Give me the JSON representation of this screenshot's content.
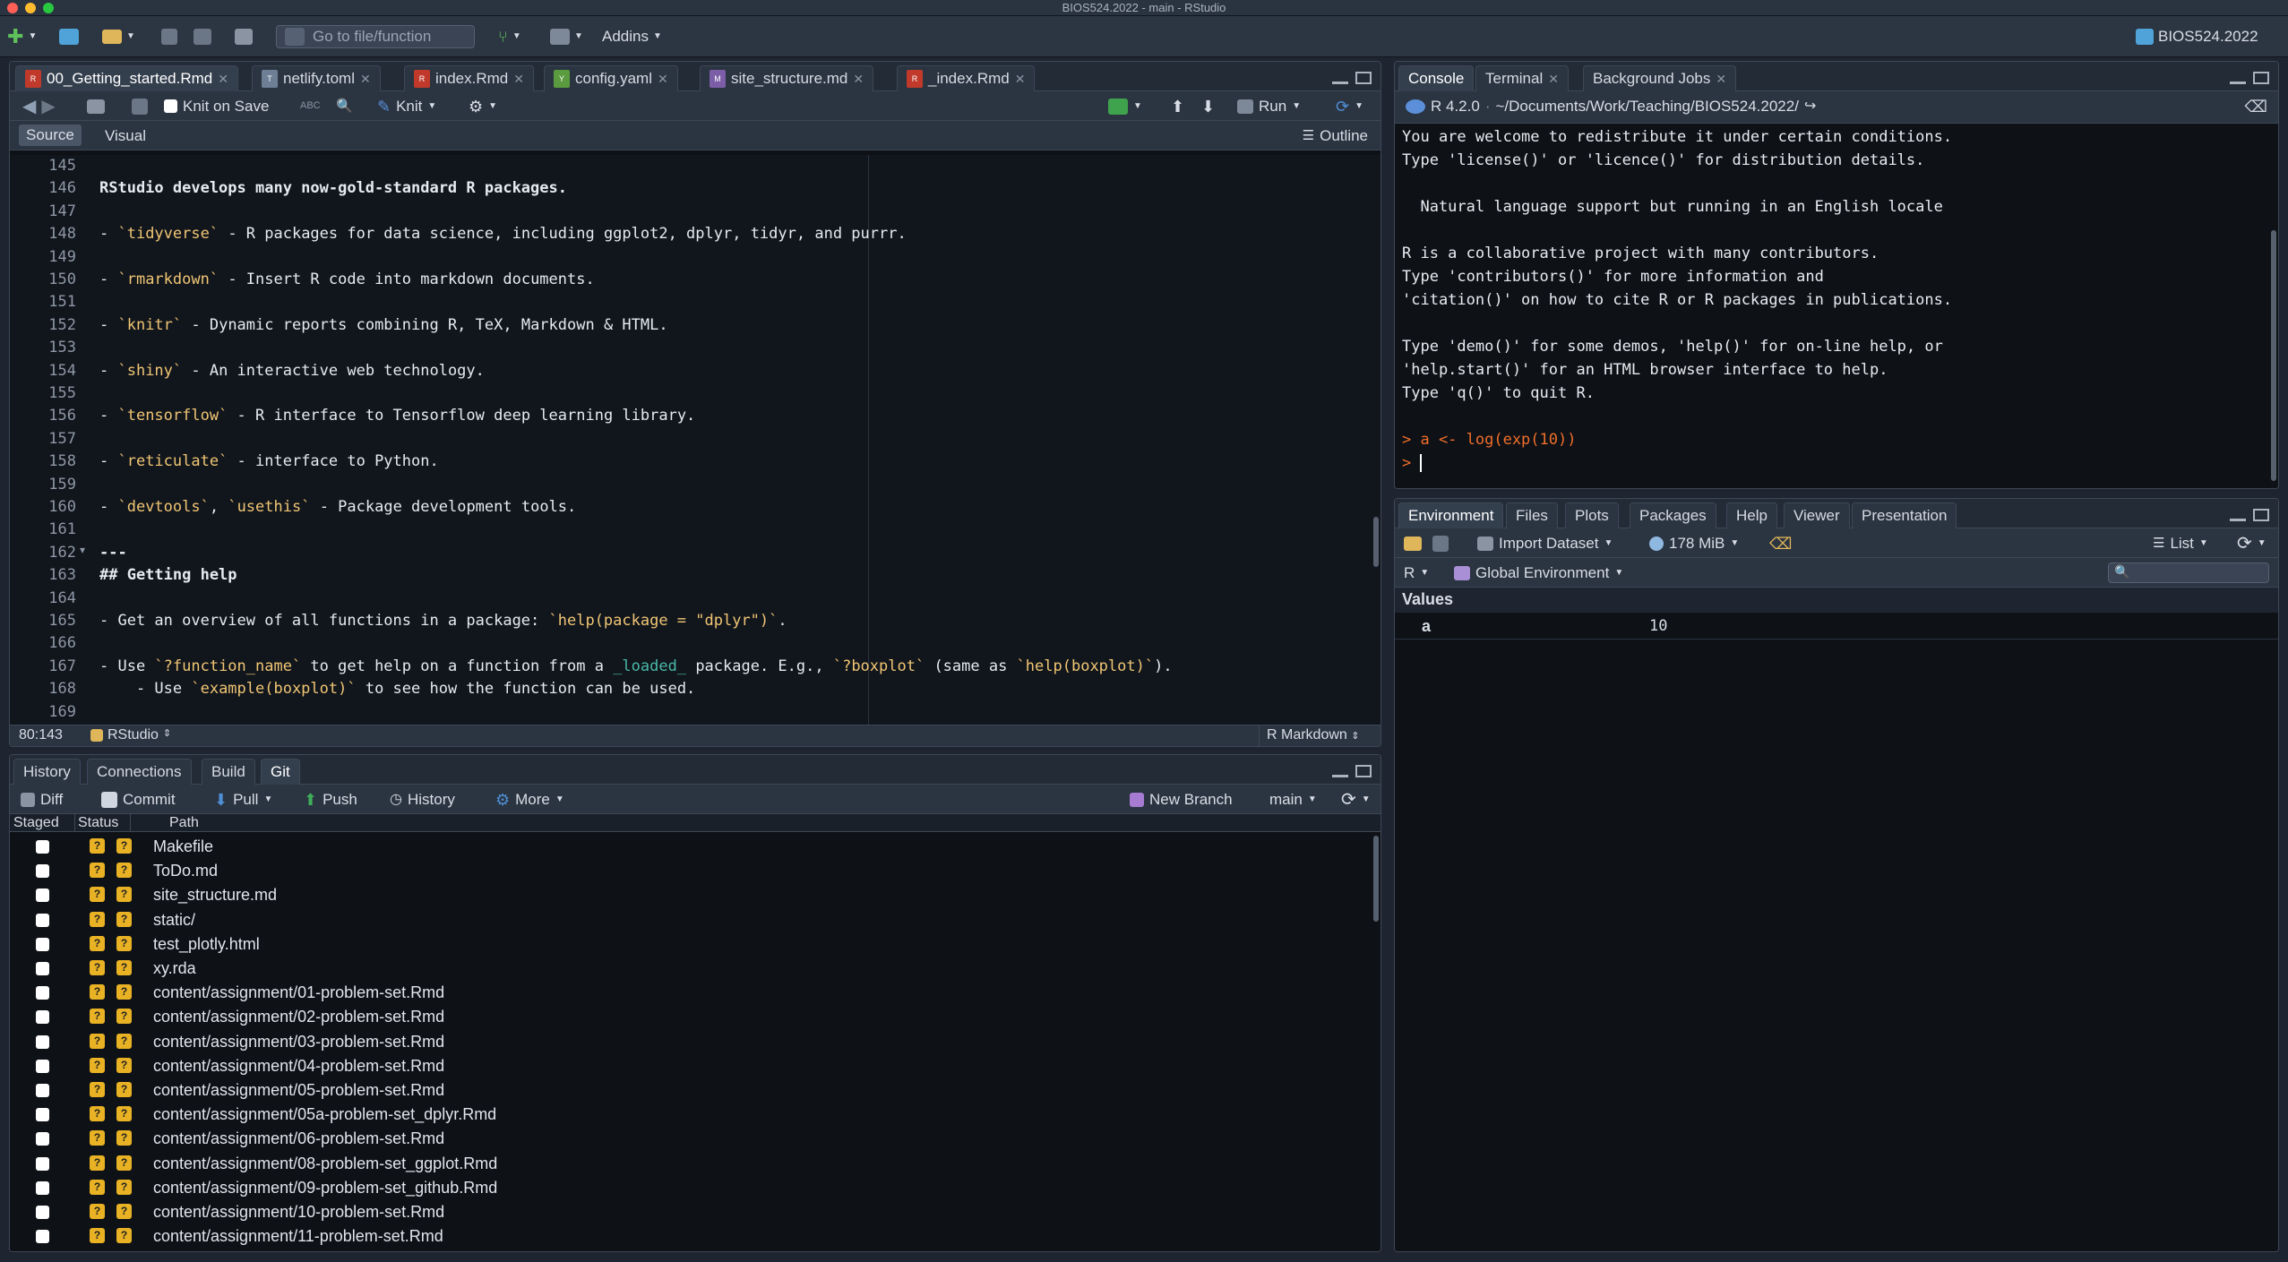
{
  "window_title": "BIOS524.2022 - main - RStudio",
  "toolbar": {
    "goto_placeholder": "Go to file/function",
    "addins": "Addins",
    "project": "BIOS524.2022"
  },
  "source_pane": {
    "tabs": [
      "00_Getting_started.Rmd",
      "netlify.toml",
      "index.Rmd",
      "config.yaml",
      "site_structure.md",
      "_index.Rmd"
    ],
    "knit_on_save": "Knit on Save",
    "knit": "Knit",
    "run": "Run",
    "mode_source": "Source",
    "mode_visual": "Visual",
    "outline": "Outline",
    "cursor_pos": "80:143",
    "scope": "RStudio",
    "filetype": "R Markdown",
    "lines": [
      {
        "n": "145",
        "text": ""
      },
      {
        "n": "146",
        "text": "RStudio develops many now-gold-standard R packages."
      },
      {
        "n": "147",
        "text": ""
      },
      {
        "n": "148",
        "text": "- `tidyverse` - R packages for data science, including ggplot2, dplyr, tidyr, and purrr."
      },
      {
        "n": "149",
        "text": ""
      },
      {
        "n": "150",
        "text": "- `rmarkdown` - Insert R code into markdown documents."
      },
      {
        "n": "151",
        "text": ""
      },
      {
        "n": "152",
        "text": "- `knitr` - Dynamic reports combining R, TeX, Markdown & HTML."
      },
      {
        "n": "153",
        "text": ""
      },
      {
        "n": "154",
        "text": "- `shiny` - An interactive web technology."
      },
      {
        "n": "155",
        "text": ""
      },
      {
        "n": "156",
        "text": "- `tensorflow` - R interface to Tensorflow deep learning library."
      },
      {
        "n": "157",
        "text": ""
      },
      {
        "n": "158",
        "text": "- `reticulate` - interface to Python."
      },
      {
        "n": "159",
        "text": ""
      },
      {
        "n": "160",
        "text": "- `devtools`, `usethis` - Package development tools."
      },
      {
        "n": "161",
        "text": ""
      },
      {
        "n": "162",
        "text": "---"
      },
      {
        "n": "163",
        "text": "## Getting help"
      },
      {
        "n": "164",
        "text": ""
      },
      {
        "n": "165",
        "text": "- Get an overview of all functions in a package: `help(package = \"dplyr\")`."
      },
      {
        "n": "166",
        "text": ""
      },
      {
        "n": "167",
        "text": "- Use `?function_name` to get help on a function from a _loaded_ package. E.g., `?boxplot` (same as `help(boxplot)`)."
      },
      {
        "n": "168",
        "text": "    - Use `example(boxplot)` to see how the function can be used."
      },
      {
        "n": "169",
        "text": ""
      }
    ]
  },
  "git_pane": {
    "tabs": [
      "History",
      "Connections",
      "Build",
      "Git"
    ],
    "toolbar": {
      "diff": "Diff",
      "commit": "Commit",
      "pull": "Pull",
      "push": "Push",
      "history": "History",
      "more": "More",
      "new_branch": "New Branch",
      "branch": "main"
    },
    "columns": [
      "Staged",
      "Status",
      "Path"
    ],
    "files": [
      "Makefile",
      "ToDo.md",
      "site_structure.md",
      "static/",
      "test_plotly.html",
      "xy.rda",
      "content/assignment/01-problem-set.Rmd",
      "content/assignment/02-problem-set.Rmd",
      "content/assignment/03-problem-set.Rmd",
      "content/assignment/04-problem-set.Rmd",
      "content/assignment/05-problem-set.Rmd",
      "content/assignment/05a-problem-set_dplyr.Rmd",
      "content/assignment/06-problem-set.Rmd",
      "content/assignment/08-problem-set_ggplot.Rmd",
      "content/assignment/09-problem-set_github.Rmd",
      "content/assignment/10-problem-set.Rmd",
      "content/assignment/11-problem-set.Rmd"
    ],
    "status_glyph": "?"
  },
  "console_pane": {
    "tabs": [
      "Console",
      "Terminal",
      "Background Jobs"
    ],
    "r_version": "R 4.2.0",
    "path": "~/Documents/Work/Teaching/BIOS524.2022/",
    "output": [
      "You are welcome to redistribute it under certain conditions.",
      "Type 'license()' or 'licence()' for distribution details.",
      "",
      "  Natural language support but running in an English locale",
      "",
      "R is a collaborative project with many contributors.",
      "Type 'contributors()' for more information and",
      "'citation()' on how to cite R or R packages in publications.",
      "",
      "Type 'demo()' for some demos, 'help()' for on-line help, or",
      "'help.start()' for an HTML browser interface to help.",
      "Type 'q()' to quit R.",
      ""
    ],
    "command": "> a <- log(exp(10))",
    "prompt": "> "
  },
  "env_pane": {
    "tabs": [
      "Environment",
      "Files",
      "Plots",
      "Packages",
      "Help",
      "Viewer",
      "Presentation"
    ],
    "import_dataset": "Import Dataset",
    "memory": "178 MiB",
    "view": "List",
    "lang": "R",
    "scope": "Global Environment",
    "section": "Values",
    "values": [
      {
        "name": "a",
        "value": "10"
      }
    ]
  },
  "colors": {
    "accent_orange": "#f06e2a",
    "yellow_code": "#f0c674",
    "status_yellow": "#e8b224"
  }
}
